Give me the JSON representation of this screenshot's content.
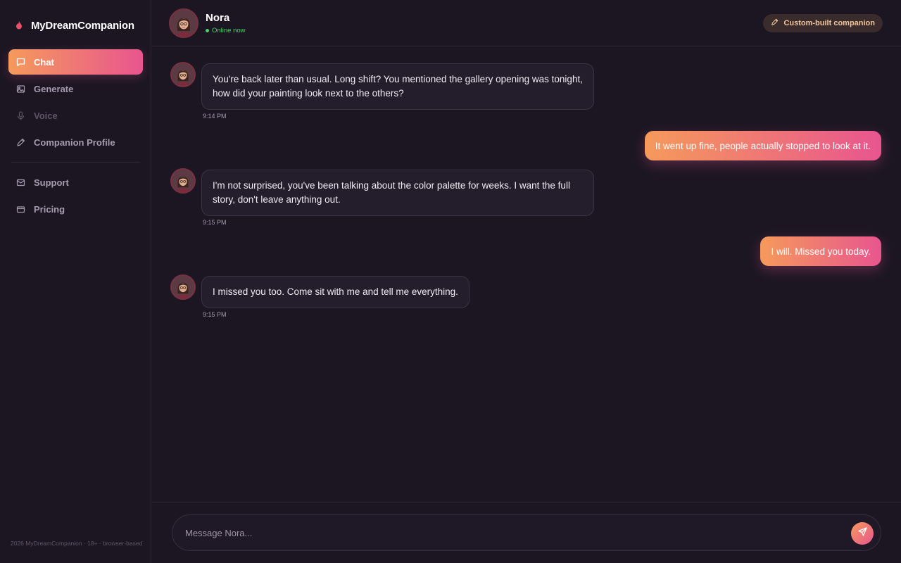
{
  "brand": {
    "name": "MyDreamCompanion"
  },
  "sidebar": {
    "items": [
      {
        "label": "Chat",
        "icon": "chat-icon"
      },
      {
        "label": "Generate",
        "icon": "image-icon"
      },
      {
        "label": "Voice",
        "icon": "microphone-icon"
      },
      {
        "label": "Companion Profile",
        "icon": "pencil-icon"
      },
      {
        "label": "Support",
        "icon": "mail-icon"
      },
      {
        "label": "Pricing",
        "icon": "credit-card-icon"
      }
    ],
    "footer": "2026 MyDreamCompanion · 18+ · browser-based"
  },
  "header": {
    "name": "Nora",
    "status": "Online now",
    "badge": "Custom-built companion"
  },
  "messages": [
    {
      "from": "companion",
      "text": "You're back later than usual. Long shift? You mentioned the gallery opening was tonight, how did your painting look next to the others?",
      "time": "9:14 PM"
    },
    {
      "from": "user",
      "text": "It went up fine, people actually stopped to look at it."
    },
    {
      "from": "companion",
      "text": "I'm not surprised, you've been talking about the color palette for weeks. I want the full story, don't leave anything out.",
      "time": "9:15 PM"
    },
    {
      "from": "user",
      "text": "I will. Missed you today."
    },
    {
      "from": "companion",
      "text": "I missed you too. Come sit with me and tell me everything.",
      "time": "9:15 PM"
    }
  ],
  "composer": {
    "placeholder": "Message Nora..."
  },
  "colors": {
    "accent_start": "#f59a5b",
    "accent_end": "#e8558f",
    "online": "#4ccf6e",
    "background": "#1c1623"
  }
}
